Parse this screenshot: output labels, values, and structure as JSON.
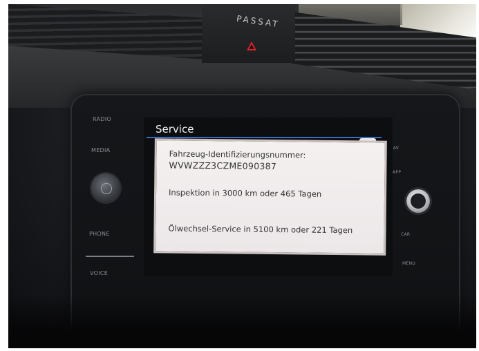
{
  "car": {
    "badge": "PASSAT"
  },
  "buttons_left": [
    "RADIO",
    "MEDIA",
    "PHONE",
    "VOICE"
  ],
  "buttons_right": [
    "NAV",
    "APP",
    "CAR",
    "MENU"
  ],
  "screen": {
    "title": "Service",
    "back_icon": "back-arrow-icon",
    "vin_label": "Fahrzeug-Identifizierungsnummer:",
    "vin_value": "WVWZZZ3CZME090387",
    "inspection": "Inspektion in 3000 km oder 465 Tagen",
    "oil_service": "Ölwechsel-Service in 5100 km oder 221 Tagen"
  },
  "colors": {
    "title_underline": "#3a6dbf",
    "panel_bg": "#f1eded",
    "hazard": "#e0202a"
  }
}
